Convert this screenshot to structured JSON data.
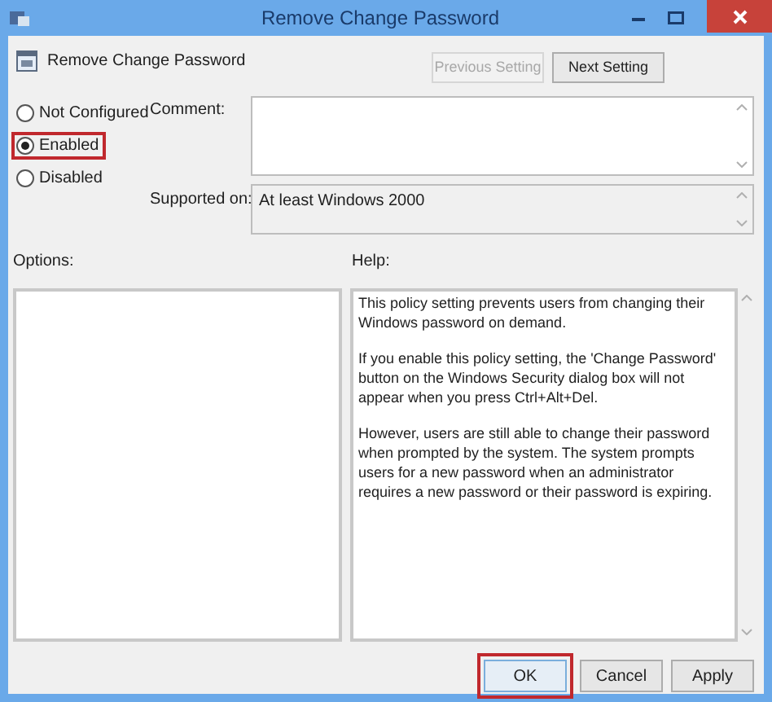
{
  "window": {
    "title": "Remove Change Password"
  },
  "policy": {
    "title": "Remove Change Password"
  },
  "nav_buttons": [
    {
      "label": "Previous Setting",
      "disabled": true
    },
    {
      "label": "Next Setting",
      "disabled": false
    }
  ],
  "states": [
    {
      "label": "Not Configured",
      "selected": false,
      "highlighted": false
    },
    {
      "label": "Enabled",
      "selected": true,
      "highlighted": true
    },
    {
      "label": "Disabled",
      "selected": false,
      "highlighted": false
    }
  ],
  "comment": {
    "label": "Comment:"
  },
  "supported": {
    "label": "Supported on:",
    "value": "At least Windows 2000"
  },
  "options": {
    "label": "Options:"
  },
  "help": {
    "label": "Help:",
    "paragraphs": [
      "This policy setting prevents users from changing their Windows password on demand.",
      "If you enable this policy setting,  the 'Change Password' button on the Windows Security dialog box will not appear when you press Ctrl+Alt+Del.",
      "However, users are still able to change their password when prompted by the system. The system prompts users for a new password when an administrator requires a new password or their password is expiring."
    ]
  },
  "buttons": [
    {
      "label": "OK",
      "highlighted": true
    },
    {
      "label": "Cancel",
      "highlighted": false
    },
    {
      "label": "Apply",
      "highlighted": false
    }
  ]
}
